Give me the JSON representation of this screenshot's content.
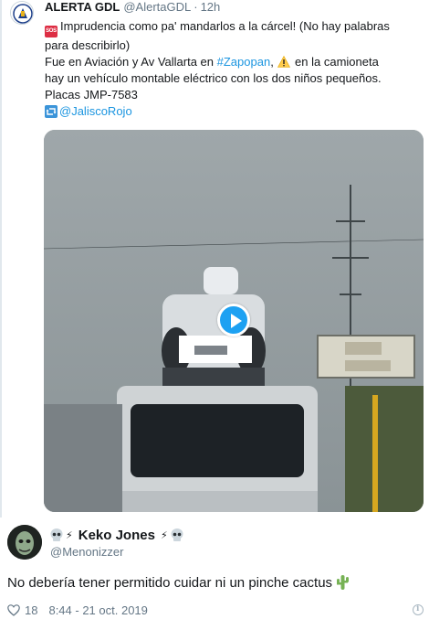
{
  "quoted_tweet": {
    "author_name": "ALERTA GDL",
    "author_handle": "@AlertaGDL",
    "separator": "·",
    "time": "12h",
    "badge_text": "SOS",
    "text_line1": "Imprudencia como pa' mandarlos a la cárcel! (No hay palabras",
    "text_line2": "para describirlo)",
    "text_line3_before": "Fue en Aviación y Av Vallarta en ",
    "hashtag": "#Zapopan",
    "text_line3_after": ", ",
    "text_line3_end": " en la camioneta",
    "text_line4": "hay un vehículo montable eléctrico con los dos niños pequeños.",
    "text_line5": "Placas JMP-7583",
    "source_link": "@JaliscoRojo",
    "video": {
      "thumbnail_icon": "video-thumbnail",
      "play_icon": "play-icon"
    }
  },
  "reply_tweet": {
    "author_name": "Keko Jones",
    "author_name_prefix": "💀",
    "bolt_symbol": "⚡",
    "author_handle": "@Menonizzer",
    "text": "No debería tener permitido cuidar ni un pinche cactus",
    "likes": "18",
    "timestamp": "8:44 - 21 oct. 2019"
  },
  "colors": {
    "link": "#1b95e0",
    "text": "#14171a",
    "muted": "#657786",
    "play": "#1da1f2",
    "sos": "#dd2e44"
  }
}
